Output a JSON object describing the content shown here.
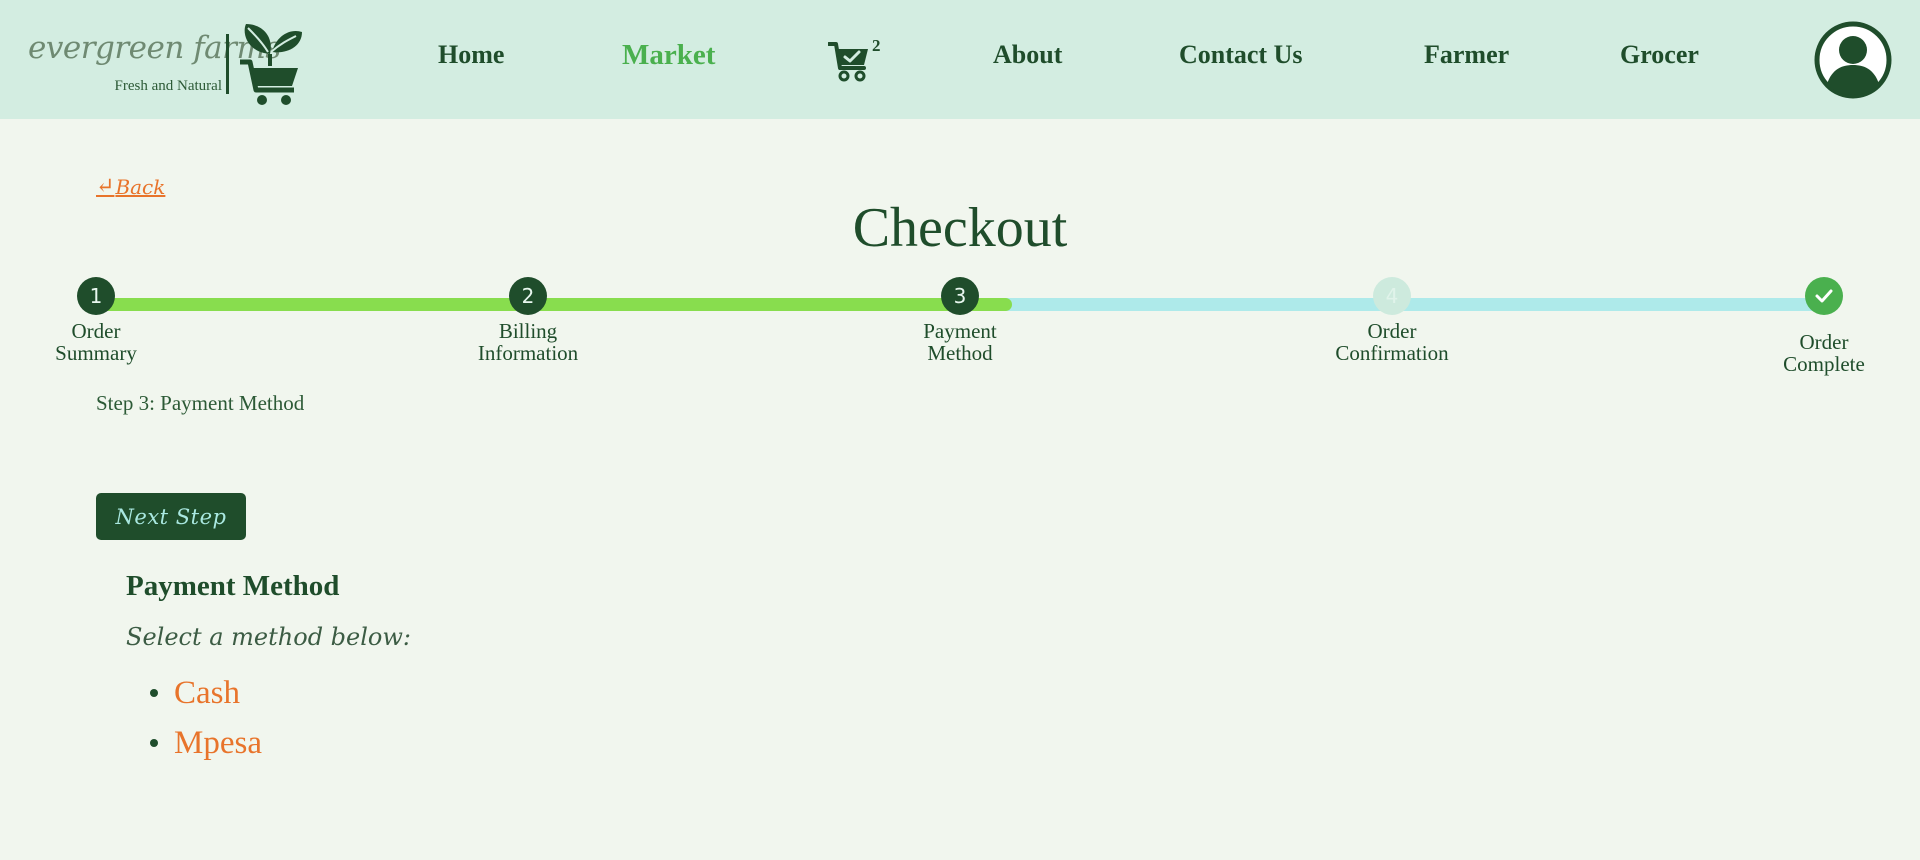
{
  "brand": {
    "name": "evergreen farms",
    "tagline": "Fresh and Natural"
  },
  "nav": {
    "links": [
      {
        "label": "Home",
        "active": false
      },
      {
        "label": "Market",
        "active": true
      },
      {
        "label": "About",
        "active": false
      },
      {
        "label": "Contact Us",
        "active": false
      },
      {
        "label": "Farmer",
        "active": false
      },
      {
        "label": "Grocer",
        "active": false
      }
    ],
    "cart_count": "2",
    "cart_icon": "cart-check-icon",
    "profile_icon": "user-avatar-icon"
  },
  "back": {
    "label": "Back",
    "icon": "return-arrow-icon"
  },
  "page_title": "Checkout",
  "stepper": {
    "progress": 0.53,
    "steps": [
      {
        "number": "1",
        "label_line1": "Order",
        "label_line2": "Summary",
        "state": "done"
      },
      {
        "number": "2",
        "label_line1": "Billing",
        "label_line2": "Information",
        "state": "done"
      },
      {
        "number": "3",
        "label_line1": "Payment",
        "label_line2": "Method",
        "state": "current"
      },
      {
        "number": "4",
        "label_line1": "Order",
        "label_line2": "Confirmation",
        "state": "pending"
      },
      {
        "number": "",
        "label_line1": "Order",
        "label_line2": "Complete",
        "state": "complete",
        "icon": "check-icon"
      }
    ],
    "caption": "Step 3: Payment Method"
  },
  "next_button": {
    "label": "Next Step"
  },
  "payment": {
    "title": "Payment Method",
    "subtitle": "Select a method below:",
    "methods": [
      "Cash",
      "Mpesa"
    ]
  },
  "colors": {
    "header_bg": "#d3ede1",
    "page_bg": "#f1f6ee",
    "primary_dark": "#1f4d2b",
    "active_link": "#4ab04e",
    "accent_orange": "#e8742b",
    "progress_fill": "#88dd4e",
    "progress_track": "#aeeaea"
  }
}
